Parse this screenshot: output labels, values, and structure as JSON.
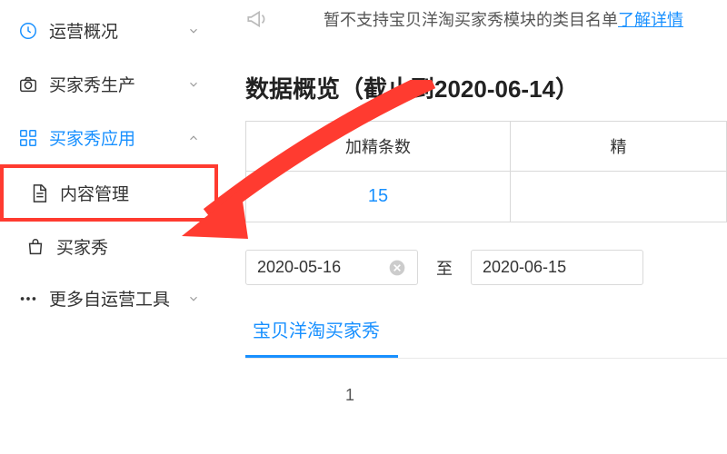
{
  "sidebar": {
    "items": [
      {
        "label": "运营概况",
        "expanded": false,
        "active": false
      },
      {
        "label": "买家秀生产",
        "expanded": false,
        "active": false
      },
      {
        "label": "买家秀应用",
        "expanded": true,
        "active": true
      },
      {
        "label": "更多自运营工具",
        "expanded": false,
        "active": false
      }
    ],
    "subitems": [
      {
        "label": "内容管理",
        "highlighted": true
      },
      {
        "label": "买家秀",
        "highlighted": false
      }
    ]
  },
  "notice": {
    "text": "暂不支持宝贝洋淘买家秀模块的类目名单",
    "link": "了解详情"
  },
  "main": {
    "section_title": "数据概览（截止到2020-06-14）",
    "table": {
      "headers": [
        "加精条数",
        "精"
      ],
      "row": [
        "15",
        ""
      ]
    },
    "date_from": "2020-05-16",
    "date_sep": "至",
    "date_to": "2020-06-15",
    "tabs": [
      "宝贝洋淘买家秀"
    ],
    "page": "1"
  }
}
